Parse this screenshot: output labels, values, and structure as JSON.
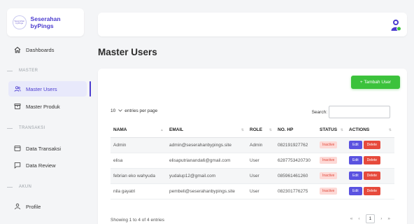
{
  "brand": {
    "logo_text": "Seserahan byPings",
    "name": "Seserahan byPings"
  },
  "sidebar": {
    "dashboard": "Dashboards",
    "section_master": "MASTER",
    "master_users": "Master Users",
    "master_produk": "Master Produk",
    "section_transaksi": "TRANSAKSI",
    "data_transaksi": "Data Transaksi",
    "data_review": "Data Review",
    "section_akun": "AKUN",
    "profile": "Profile"
  },
  "page": {
    "title": "Master Users"
  },
  "toolbar": {
    "add_label": "+ Tambah User"
  },
  "table_controls": {
    "entries_value": "10",
    "entries_label": "entries per page",
    "search_label": "Search:",
    "search_value": ""
  },
  "table": {
    "headers": [
      "NAMA",
      "EMAIL",
      "ROLE",
      "NO. HP",
      "STATUS",
      "ACTIONS"
    ],
    "rows": [
      {
        "nama": "Admin",
        "email": "admin@seserahanbypings.site",
        "role": "Admin",
        "hp": "082191927762",
        "status": "Inactive"
      },
      {
        "nama": "elisa",
        "email": "elisaputriananda6@gmail.com",
        "role": "User",
        "hp": "6287753420730",
        "status": "Inactive"
      },
      {
        "nama": "febrian eko wahyuda",
        "email": "yudalup12@gmail.com",
        "role": "User",
        "hp": "085961461260",
        "status": "Inactive"
      },
      {
        "nama": "nila gayatri",
        "email": "pembeli@seserahanbypings.site",
        "role": "User",
        "hp": "082301776275",
        "status": "Inactive"
      }
    ],
    "edit_label": "Edit",
    "delete_label": "Delete"
  },
  "footer": {
    "info": "Showing 1 to 4 of 4 entries",
    "first": "«",
    "prev": "‹",
    "page": "1",
    "next": "›",
    "last": "»"
  },
  "colors": {
    "accent": "#4b3ccf",
    "success": "#3cc23c",
    "danger": "#e64a3c",
    "edit": "#5a52e0"
  },
  "icons": {
    "dashboard": "home-icon",
    "users": "users-icon",
    "produk": "box-icon",
    "transaksi": "receipt-icon",
    "review": "chat-icon",
    "profile": "user-icon",
    "user_menu": "user-circle-icon"
  }
}
